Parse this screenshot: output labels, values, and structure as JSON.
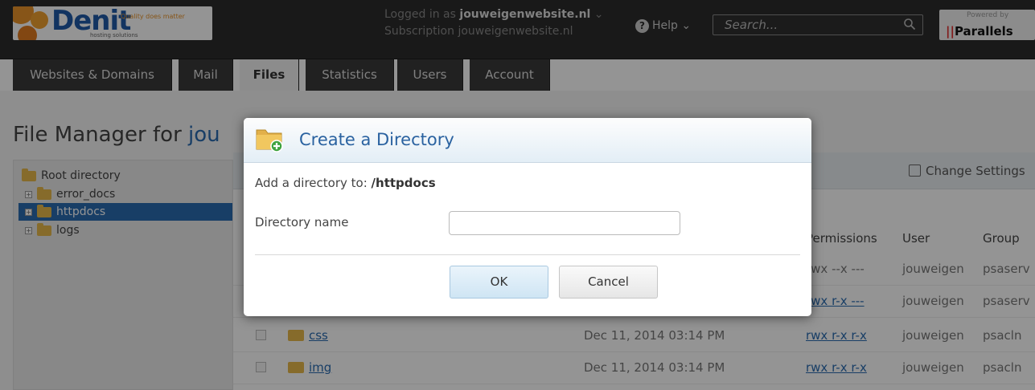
{
  "brand": {
    "name": "Denit",
    "tagline": "Quality does matter",
    "sub": "hosting solutions"
  },
  "header": {
    "logged_in_label": "Logged in as",
    "logged_in_user": "jouweigenwebsite.nl",
    "subscription_label": "Subscription",
    "subscription_value": "jouweigenwebsite.nl",
    "help_label": "Help",
    "search_placeholder": "Search...",
    "powered_by": "Powered by",
    "parallels": "Parallels"
  },
  "tabs": [
    {
      "label": "Websites & Domains"
    },
    {
      "label": "Mail"
    },
    {
      "label": "Files"
    },
    {
      "label": "Statistics"
    },
    {
      "label": "Users"
    },
    {
      "label": "Account"
    }
  ],
  "page": {
    "title_prefix": "File Manager for",
    "title_domain": "jou"
  },
  "tree": {
    "root": "Root directory",
    "items": [
      {
        "label": "error_docs"
      },
      {
        "label": "httpdocs"
      },
      {
        "label": "logs"
      }
    ]
  },
  "toolbar": {
    "change_settings": "Change Settings"
  },
  "table": {
    "headers": {
      "permissions": "Permissions",
      "user": "User",
      "group": "Group"
    },
    "rows": [
      {
        "name": "",
        "date": "",
        "perms": "rwx --x ---",
        "user": "jouweigen",
        "group": "psaserv"
      },
      {
        "name": "",
        "date": "",
        "perms": "rwx r-x ---",
        "user": "jouweigen",
        "group": "psaserv"
      },
      {
        "name": "css",
        "date": "Dec 11, 2014 03:14 PM",
        "perms": "rwx r-x r-x",
        "user": "jouweigen",
        "group": "psacln"
      },
      {
        "name": "img",
        "date": "Dec 11, 2014 03:14 PM",
        "perms": "rwx r-x r-x",
        "user": "jouweigen",
        "group": "psacln"
      }
    ]
  },
  "dialog": {
    "title": "Create a Directory",
    "sub_label": "Add a directory to:",
    "sub_path": "/httpdocs",
    "field_label": "Directory name",
    "field_value": "",
    "ok": "OK",
    "cancel": "Cancel"
  },
  "colors": {
    "accent": "#2a6bb0",
    "topbar": "#2b2b2b",
    "folder": "#e7b94b"
  }
}
